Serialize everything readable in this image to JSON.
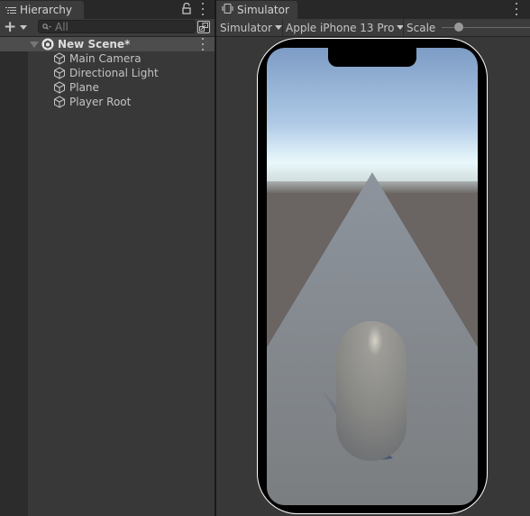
{
  "hierarchy": {
    "tab_label": "Hierarchy",
    "add_button_label": "+",
    "search_placeholder": "All",
    "scene": {
      "name": "New Scene*",
      "expanded": true
    },
    "items": [
      {
        "label": "Main Camera",
        "icon": "gameobject-cube-icon"
      },
      {
        "label": "Directional Light",
        "icon": "gameobject-cube-icon"
      },
      {
        "label": "Plane",
        "icon": "gameobject-cube-icon"
      },
      {
        "label": "Player Root",
        "icon": "gameobject-cube-icon"
      }
    ]
  },
  "simulator": {
    "tab_label": "Simulator",
    "mode_dropdown": "Simulator",
    "device_dropdown": "Apple iPhone 13 Pro",
    "scale_label": "Scale",
    "scale_value": 0.05
  },
  "colors": {
    "panel_bg": "#383838",
    "tab_bar_bg": "#282828",
    "selected_row_bg": "#4d4d4d",
    "sky_top": "#7d9dc6",
    "horizon": "#e8f6fa",
    "ground": "#6a6462",
    "plane": "#8a9099",
    "capsule": "#8a8a86"
  }
}
